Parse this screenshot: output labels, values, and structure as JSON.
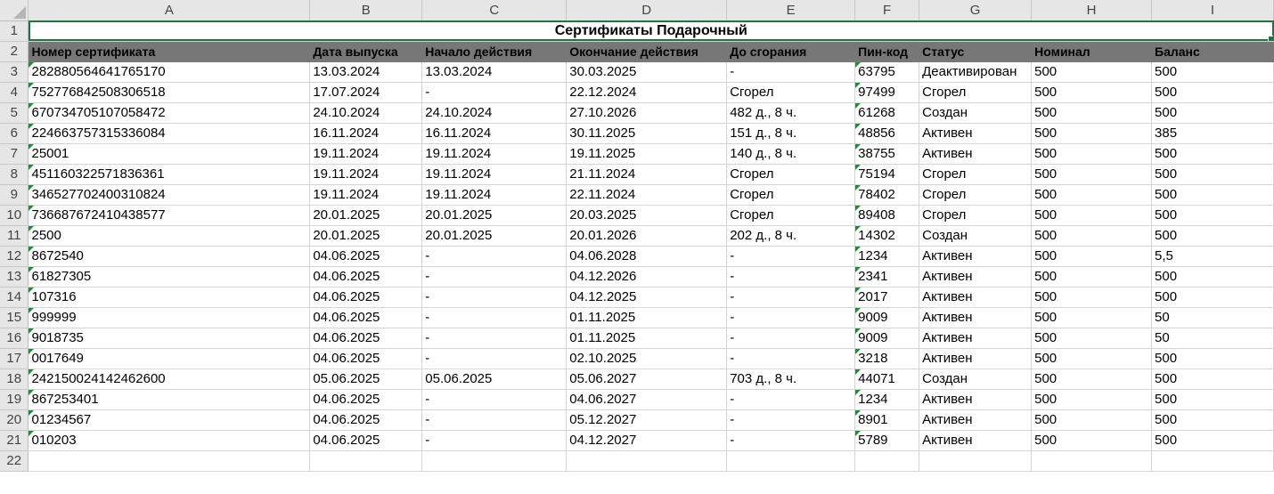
{
  "columns": [
    "A",
    "B",
    "C",
    "D",
    "E",
    "F",
    "G",
    "H",
    "I"
  ],
  "row_numbers": [
    "1",
    "2",
    "3",
    "4",
    "5",
    "6",
    "7",
    "8",
    "9",
    "10",
    "11",
    "12",
    "13",
    "14",
    "15",
    "16",
    "17",
    "18",
    "19",
    "20",
    "21",
    "22"
  ],
  "title": "Сертификаты Подарочный",
  "headers": [
    "Номер сертификата",
    "Дата выпуска",
    "Начало действия",
    "Окончание действия",
    "До сгорания",
    "Пин-код",
    "Статус",
    "Номинал",
    "Баланс"
  ],
  "rows": [
    [
      "282880564641765170",
      "13.03.2024",
      "13.03.2024",
      "30.03.2025",
      "-",
      "63795",
      "Деактивирован",
      "500",
      "500"
    ],
    [
      "752776842508306518",
      "17.07.2024",
      "-",
      "22.12.2024",
      "Сгорел",
      "97499",
      "Сгорел",
      "500",
      "500"
    ],
    [
      "670734705107058472",
      "24.10.2024",
      "24.10.2024",
      "27.10.2026",
      "482 д., 8 ч.",
      "61268",
      "Создан",
      "500",
      "500"
    ],
    [
      "224663757315336084",
      "16.11.2024",
      "16.11.2024",
      "30.11.2025",
      "151 д., 8 ч.",
      "48856",
      "Активен",
      "500",
      "385"
    ],
    [
      "25001",
      "19.11.2024",
      "19.11.2024",
      "19.11.2025",
      "140 д., 8 ч.",
      "38755",
      "Активен",
      "500",
      "500"
    ],
    [
      "451160322571836361",
      "19.11.2024",
      "19.11.2024",
      "21.11.2024",
      "Сгорел",
      "75194",
      "Сгорел",
      "500",
      "500"
    ],
    [
      "346527702400310824",
      "19.11.2024",
      "19.11.2024",
      "22.11.2024",
      "Сгорел",
      "78402",
      "Сгорел",
      "500",
      "500"
    ],
    [
      "736687672410438577",
      "20.01.2025",
      "20.01.2025",
      "20.03.2025",
      "Сгорел",
      "89408",
      "Сгорел",
      "500",
      "500"
    ],
    [
      "2500",
      "20.01.2025",
      "20.01.2025",
      "20.01.2026",
      "202 д., 8 ч.",
      "14302",
      "Создан",
      "500",
      "500"
    ],
    [
      "8672540",
      "04.06.2025",
      "-",
      "04.06.2028",
      "-",
      "1234",
      "Активен",
      "500",
      "5,5"
    ],
    [
      "61827305",
      "04.06.2025",
      "-",
      "04.12.2026",
      "-",
      "2341",
      "Активен",
      "500",
      "500"
    ],
    [
      "107316",
      "04.06.2025",
      "-",
      "04.12.2025",
      "-",
      "2017",
      "Активен",
      "500",
      "500"
    ],
    [
      "999999",
      "04.06.2025",
      "-",
      "01.11.2025",
      "-",
      "9009",
      "Активен",
      "500",
      "50"
    ],
    [
      "9018735",
      "04.06.2025",
      "-",
      "01.11.2025",
      "-",
      "9009",
      "Активен",
      "500",
      "50"
    ],
    [
      "0017649",
      "04.06.2025",
      "-",
      "02.10.2025",
      "-",
      "3218",
      "Активен",
      "500",
      "500"
    ],
    [
      "242150024142462600",
      "05.06.2025",
      "05.06.2025",
      "05.06.2027",
      "703 д., 8 ч.",
      "44071",
      "Создан",
      "500",
      "500"
    ],
    [
      "867253401",
      "04.06.2025",
      "-",
      "04.06.2027",
      "-",
      "1234",
      "Активен",
      "500",
      "500"
    ],
    [
      "01234567",
      "04.06.2025",
      "-",
      "05.12.2027",
      "-",
      "8901",
      "Активен",
      "500",
      "500"
    ],
    [
      "010203",
      "04.06.2025",
      "-",
      "04.12.2027",
      "-",
      "5789",
      "Активен",
      "500",
      "500"
    ]
  ]
}
